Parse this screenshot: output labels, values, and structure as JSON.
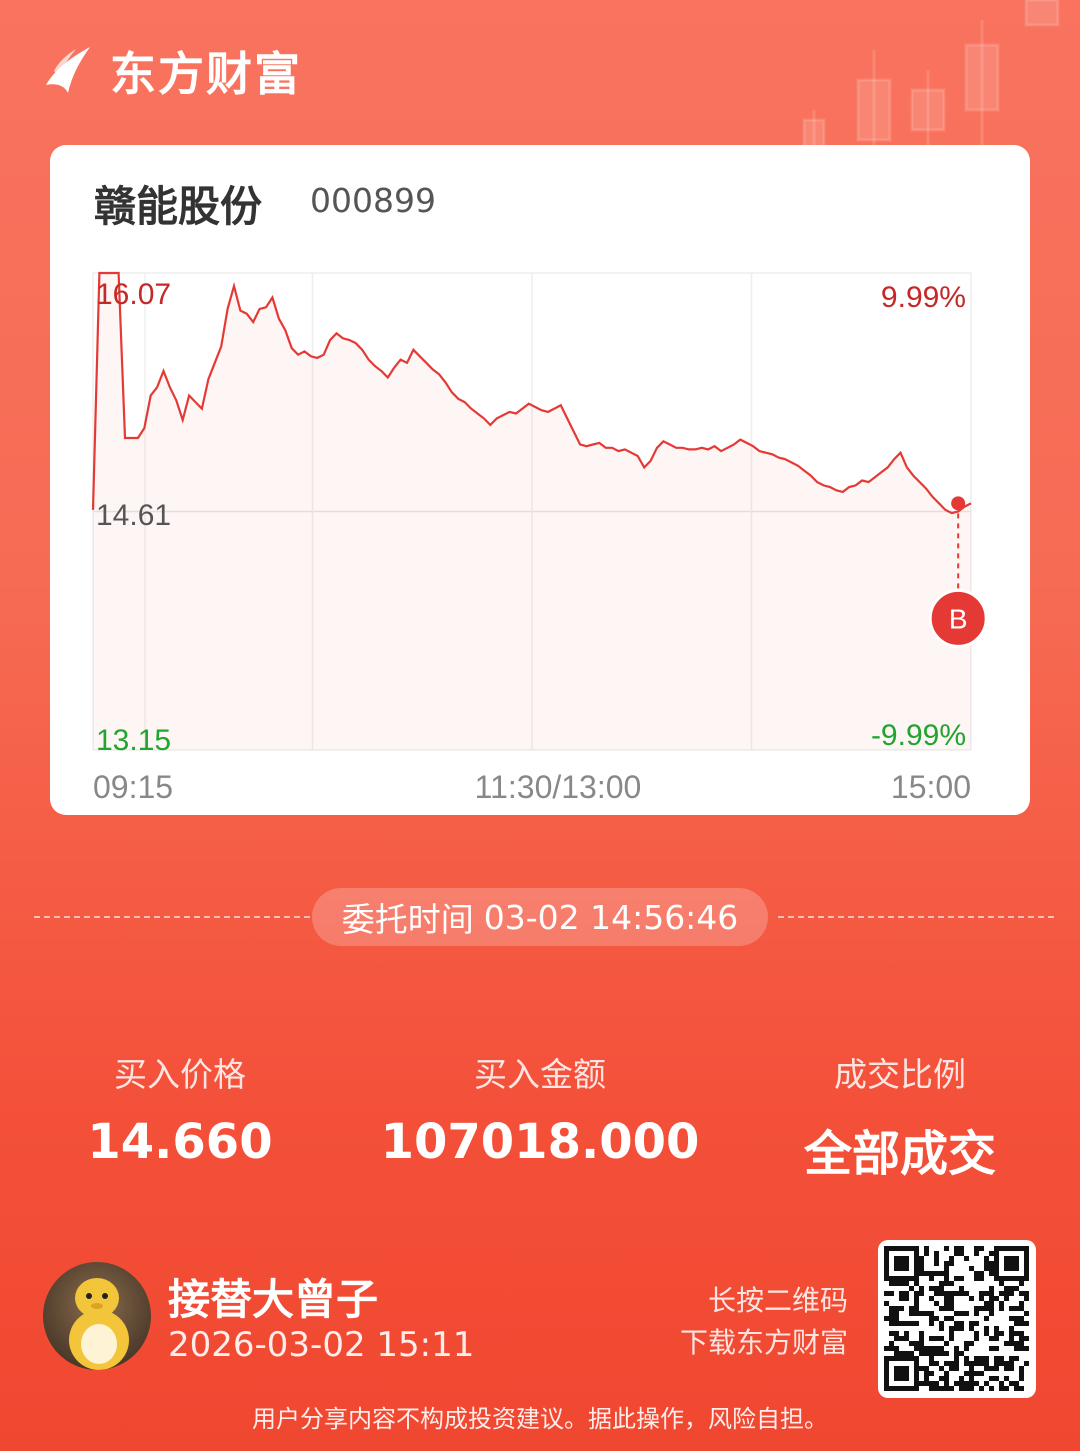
{
  "brand": {
    "name": "东方财富"
  },
  "stock": {
    "name": "赣能股份",
    "code": "000899"
  },
  "chart_data": {
    "type": "line",
    "prev_close": 14.61,
    "ylim": [
      13.15,
      16.07
    ],
    "y_tick_labels": {
      "top": "16.07",
      "mid": "14.61",
      "bottom": "13.15"
    },
    "pct_labels": {
      "top": "9.99%",
      "bottom": "-9.99%"
    },
    "x_tick_labels": [
      "09:15",
      "11:30/13:00",
      "15:00"
    ],
    "series": [
      {
        "values": [
          14.62,
          16.07,
          16.07,
          16.07,
          16.07,
          15.06,
          15.06,
          15.06,
          15.12,
          15.32,
          15.37,
          15.47,
          15.37,
          15.29,
          15.17,
          15.32,
          15.28,
          15.24,
          15.42,
          15.52,
          15.62,
          15.85,
          15.99,
          15.84,
          15.82,
          15.77,
          15.85,
          15.86,
          15.92,
          15.79,
          15.72,
          15.61,
          15.57,
          15.59,
          15.56,
          15.55,
          15.57,
          15.66,
          15.7,
          15.67,
          15.66,
          15.64,
          15.6,
          15.54,
          15.5,
          15.47,
          15.43,
          15.49,
          15.54,
          15.52,
          15.6,
          15.56,
          15.52,
          15.48,
          15.45,
          15.4,
          15.34,
          15.3,
          15.28,
          15.24,
          15.21,
          15.18,
          15.14,
          15.18,
          15.2,
          15.22,
          15.21,
          15.24,
          15.27,
          15.25,
          15.23,
          15.22,
          15.24,
          15.26,
          15.18,
          15.1,
          15.02,
          15.01,
          15.02,
          15.03,
          15.0,
          15.0,
          14.98,
          14.99,
          14.97,
          14.95,
          14.88,
          14.92,
          15.0,
          15.04,
          15.02,
          15.0,
          15.0,
          14.99,
          14.99,
          15.0,
          14.99,
          15.01,
          14.98,
          15.0,
          15.02,
          15.05,
          15.03,
          15.01,
          14.98,
          14.97,
          14.96,
          14.94,
          14.93,
          14.91,
          14.89,
          14.86,
          14.83,
          14.79,
          14.77,
          14.76,
          14.74,
          14.73,
          14.76,
          14.77,
          14.8,
          14.79,
          14.82,
          14.85,
          14.88,
          14.93,
          14.97,
          14.88,
          14.83,
          14.79,
          14.75,
          14.7,
          14.66,
          14.62,
          14.6,
          14.61,
          14.64,
          14.66
        ]
      }
    ],
    "grid": true,
    "marker": {
      "label": "B",
      "price": 14.66
    }
  },
  "order": {
    "label": "委托时间",
    "time": "03-02 14:56:46"
  },
  "stats": [
    {
      "label": "买入价格",
      "value": "14.660"
    },
    {
      "label": "买入金额",
      "value": "107018.000"
    },
    {
      "label": "成交比例",
      "value": "全部成交"
    }
  ],
  "user": {
    "name": "接替大曾子",
    "datetime": "2026-03-02 15:11"
  },
  "qr": {
    "hint_line1": "长按二维码",
    "hint_line2": "下载东方财富"
  },
  "disclaimer": "用户分享内容不构成投资建议。据此操作，风险自担。",
  "colors": {
    "up": "#e53935",
    "down": "#21a52f",
    "accent": "#f4513a"
  }
}
